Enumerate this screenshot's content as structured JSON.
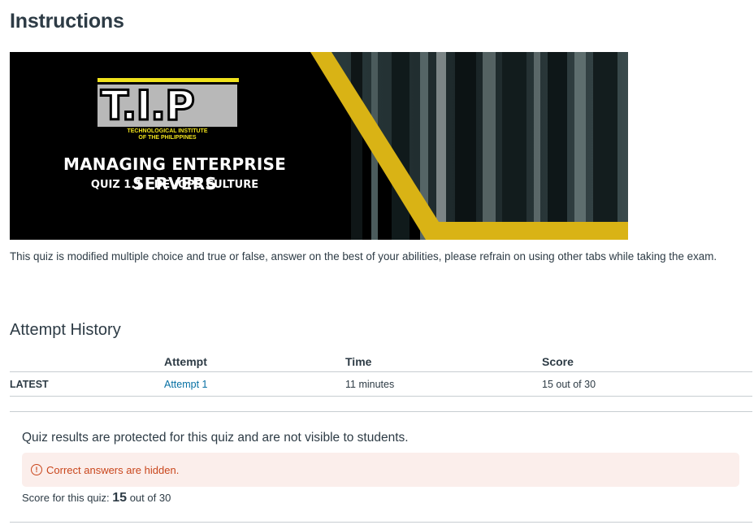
{
  "page": {
    "title": "Instructions",
    "description": "This quiz is modified multiple choice and true or false, answer on the best of your abilities, please refrain on using other tabs while taking the exam."
  },
  "banner": {
    "logo_text": "T.I.P",
    "institute_line1": "TECHNOLOGICAL INSTITUTE",
    "institute_line2": "OF THE PHILIPPINES",
    "course_title": "MANAGING ENTERPRISE SERVERS",
    "quiz_title": "QUIZ 1.1 : DEVOPS CULTURE",
    "accent_color": "#d9b315"
  },
  "history": {
    "heading": "Attempt History",
    "columns": [
      "",
      "Attempt",
      "Time",
      "Score"
    ],
    "rows": [
      {
        "label": "LATEST",
        "attempt": "Attempt 1",
        "time": "11 minutes",
        "score": "15 out of 30"
      }
    ]
  },
  "results": {
    "protected_message": "Quiz results are protected for this quiz and are not visible to students.",
    "alert_icon": "warning-circle-icon",
    "alert_text": "Correct answers are hidden.",
    "score_label": "Score for this quiz:",
    "score_value": "15",
    "score_total": "out of 30",
    "alert_color": "#c9461c"
  }
}
